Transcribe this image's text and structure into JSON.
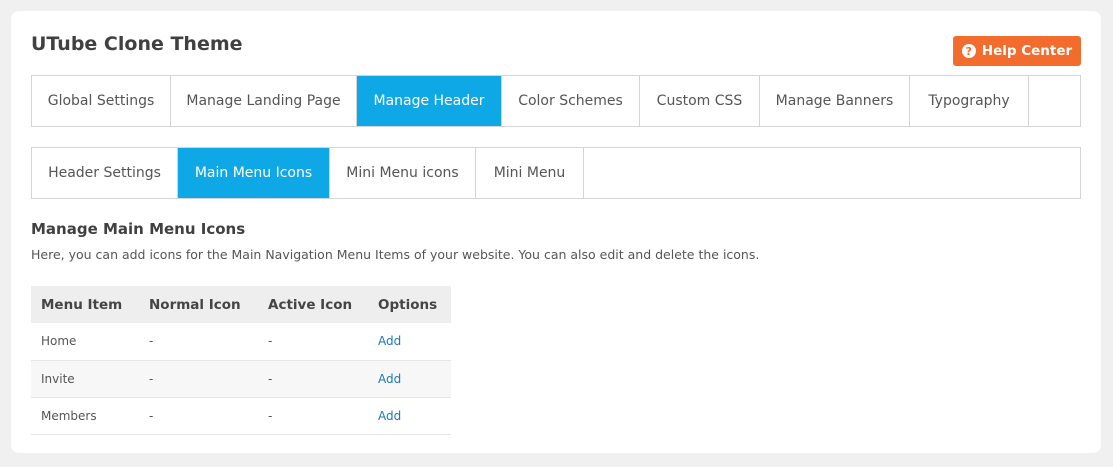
{
  "page": {
    "title": "UTube Clone Theme"
  },
  "help": {
    "label": "Help Center",
    "icon": "question-circle-icon"
  },
  "main_tabs": [
    {
      "label": "Global Settings",
      "active": false
    },
    {
      "label": "Manage Landing Page",
      "active": false
    },
    {
      "label": "Manage Header",
      "active": true
    },
    {
      "label": "Color Schemes",
      "active": false
    },
    {
      "label": "Custom CSS",
      "active": false
    },
    {
      "label": "Manage Banners",
      "active": false
    },
    {
      "label": "Typography",
      "active": false
    }
  ],
  "sub_tabs": [
    {
      "label": "Header Settings",
      "active": false
    },
    {
      "label": "Main Menu Icons",
      "active": true
    },
    {
      "label": "Mini Menu icons",
      "active": false
    },
    {
      "label": "Mini Menu",
      "active": false
    }
  ],
  "section": {
    "title": "Manage Main Menu Icons",
    "description": "Here, you can add icons for the Main Navigation Menu Items of your website. You can also edit and delete the icons."
  },
  "table": {
    "headers": [
      "Menu Item",
      "Normal Icon",
      "Active Icon",
      "Options"
    ],
    "rows": [
      {
        "item": "Home",
        "normal": "-",
        "active": "-",
        "option": "Add"
      },
      {
        "item": "Invite",
        "normal": "-",
        "active": "-",
        "option": "Add"
      },
      {
        "item": "Members",
        "normal": "-",
        "active": "-",
        "option": "Add"
      }
    ]
  },
  "colors": {
    "accent": "#0ea8e6",
    "help_button": "#f26c2e",
    "link": "#1a7ab8"
  }
}
